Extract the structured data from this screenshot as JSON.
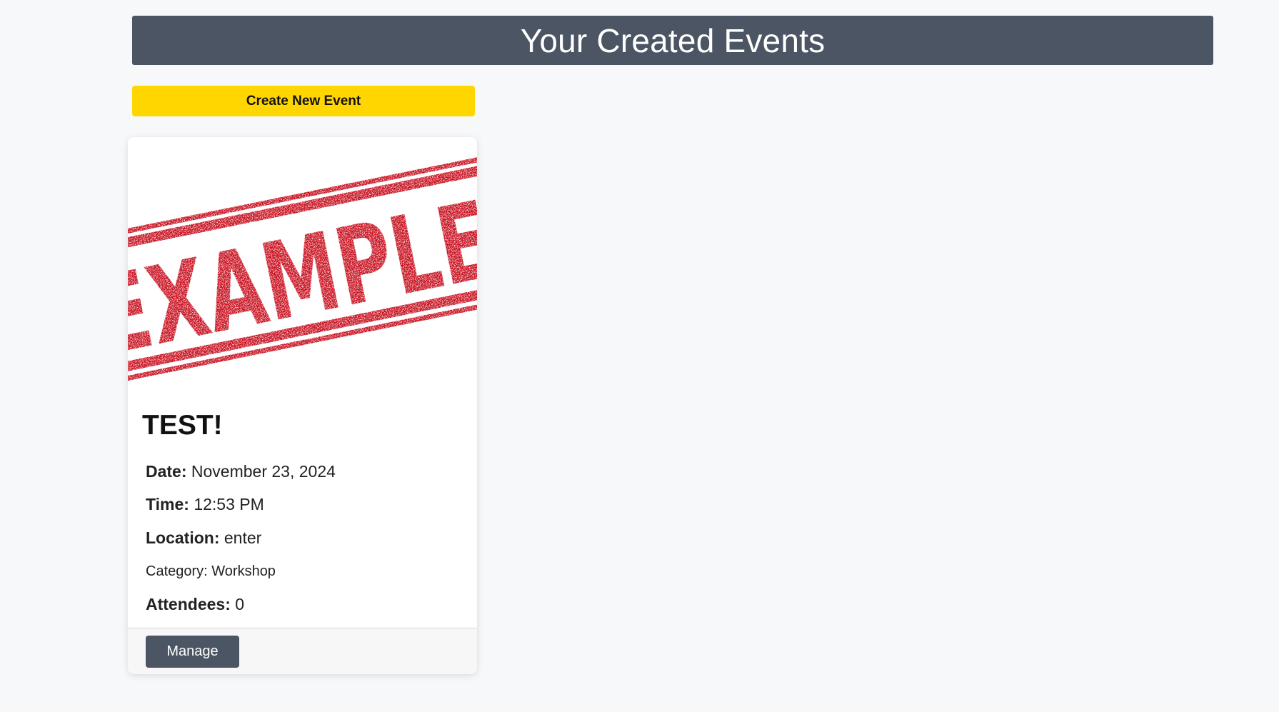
{
  "header": {
    "title": "Your Created Events"
  },
  "actions": {
    "create_label": "Create New Event"
  },
  "events": [
    {
      "image_text": "EXAMPLE",
      "title": "TEST!",
      "date_label": "Date:",
      "date": "November 23, 2024",
      "time_label": "Time:",
      "time": "12:53 PM",
      "location_label": "Location:",
      "location": "enter",
      "category": "Category: Workshop",
      "attendees_label": "Attendees:",
      "attendees": "0",
      "manage_label": "Manage"
    }
  ],
  "colors": {
    "header_bg": "#4b5563",
    "create_button_bg": "#ffd600",
    "stamp_red": "#c8101e",
    "manage_button_bg": "#4b5563",
    "page_bg": "#f7f8fa"
  }
}
